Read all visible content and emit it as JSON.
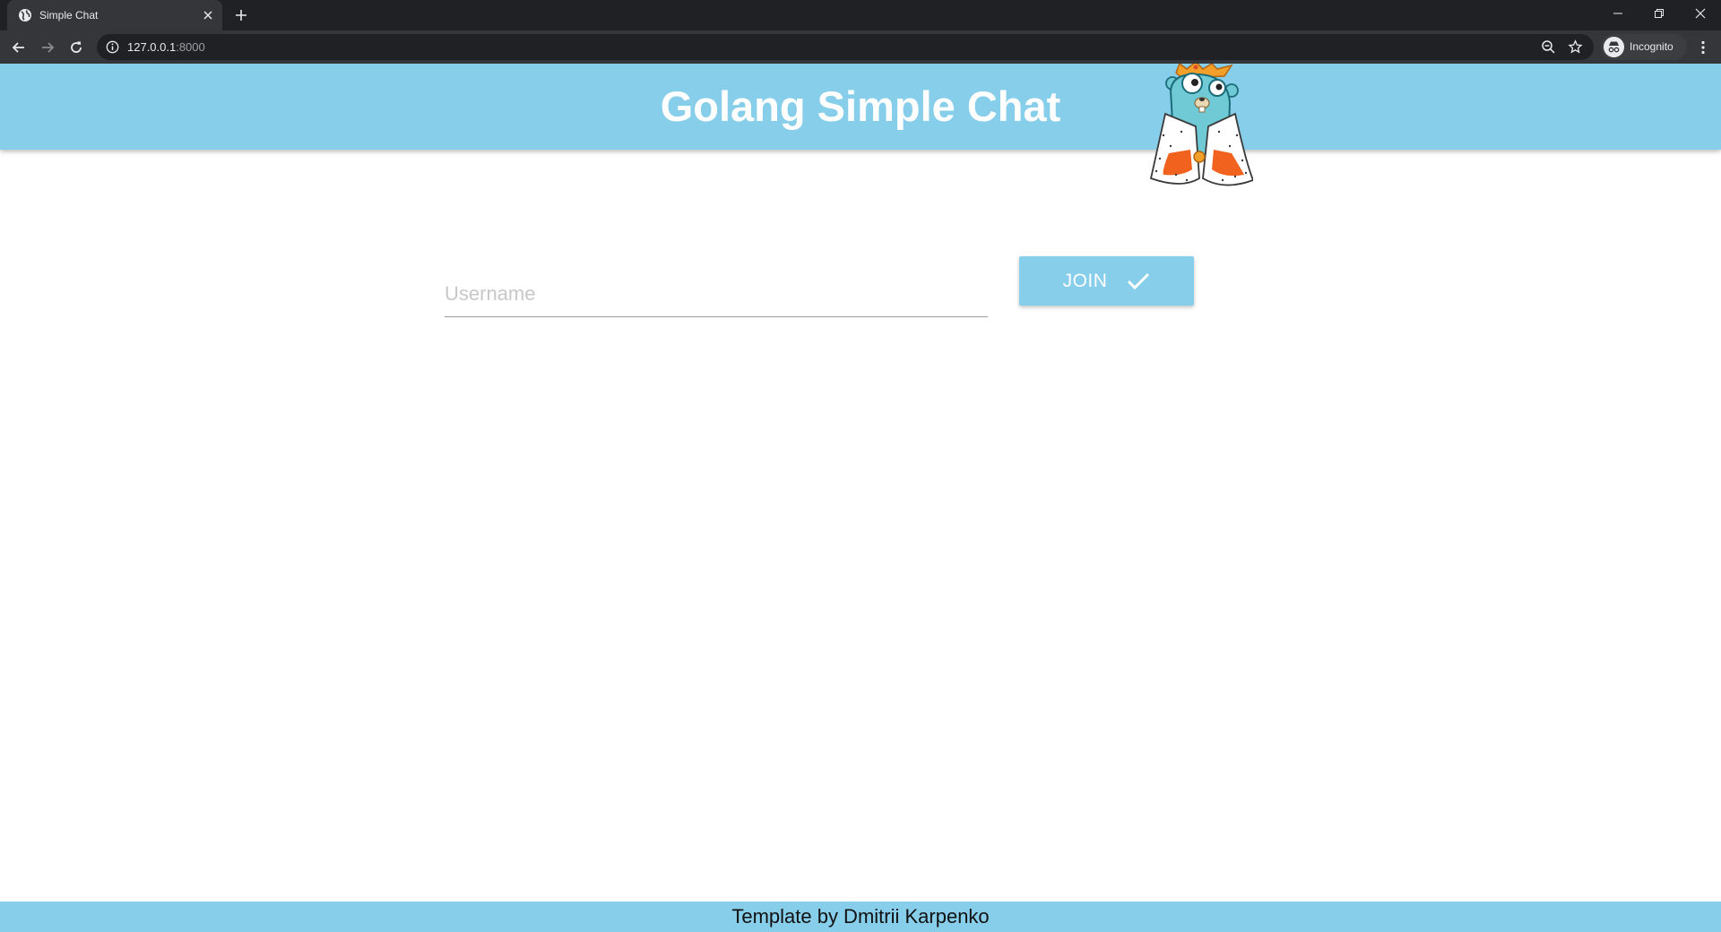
{
  "browser": {
    "tab": {
      "title": "Simple Chat",
      "favicon": "globe-icon"
    },
    "address": {
      "host": "127.0.0.1",
      "port": ":8000"
    },
    "profile_label": "Incognito"
  },
  "header": {
    "title": "Golang Simple Chat",
    "mascot": "gopher-king-mascot"
  },
  "join_form": {
    "username_placeholder": "Username",
    "username_value": "",
    "join_label": "JOIN",
    "join_icon": "check-icon"
  },
  "footer": {
    "text": "Template by Dmitrii Karpenko"
  },
  "colors": {
    "accent": "#87ceeb",
    "chrome_dark": "#202124",
    "chrome_toolbar": "#35363a"
  }
}
